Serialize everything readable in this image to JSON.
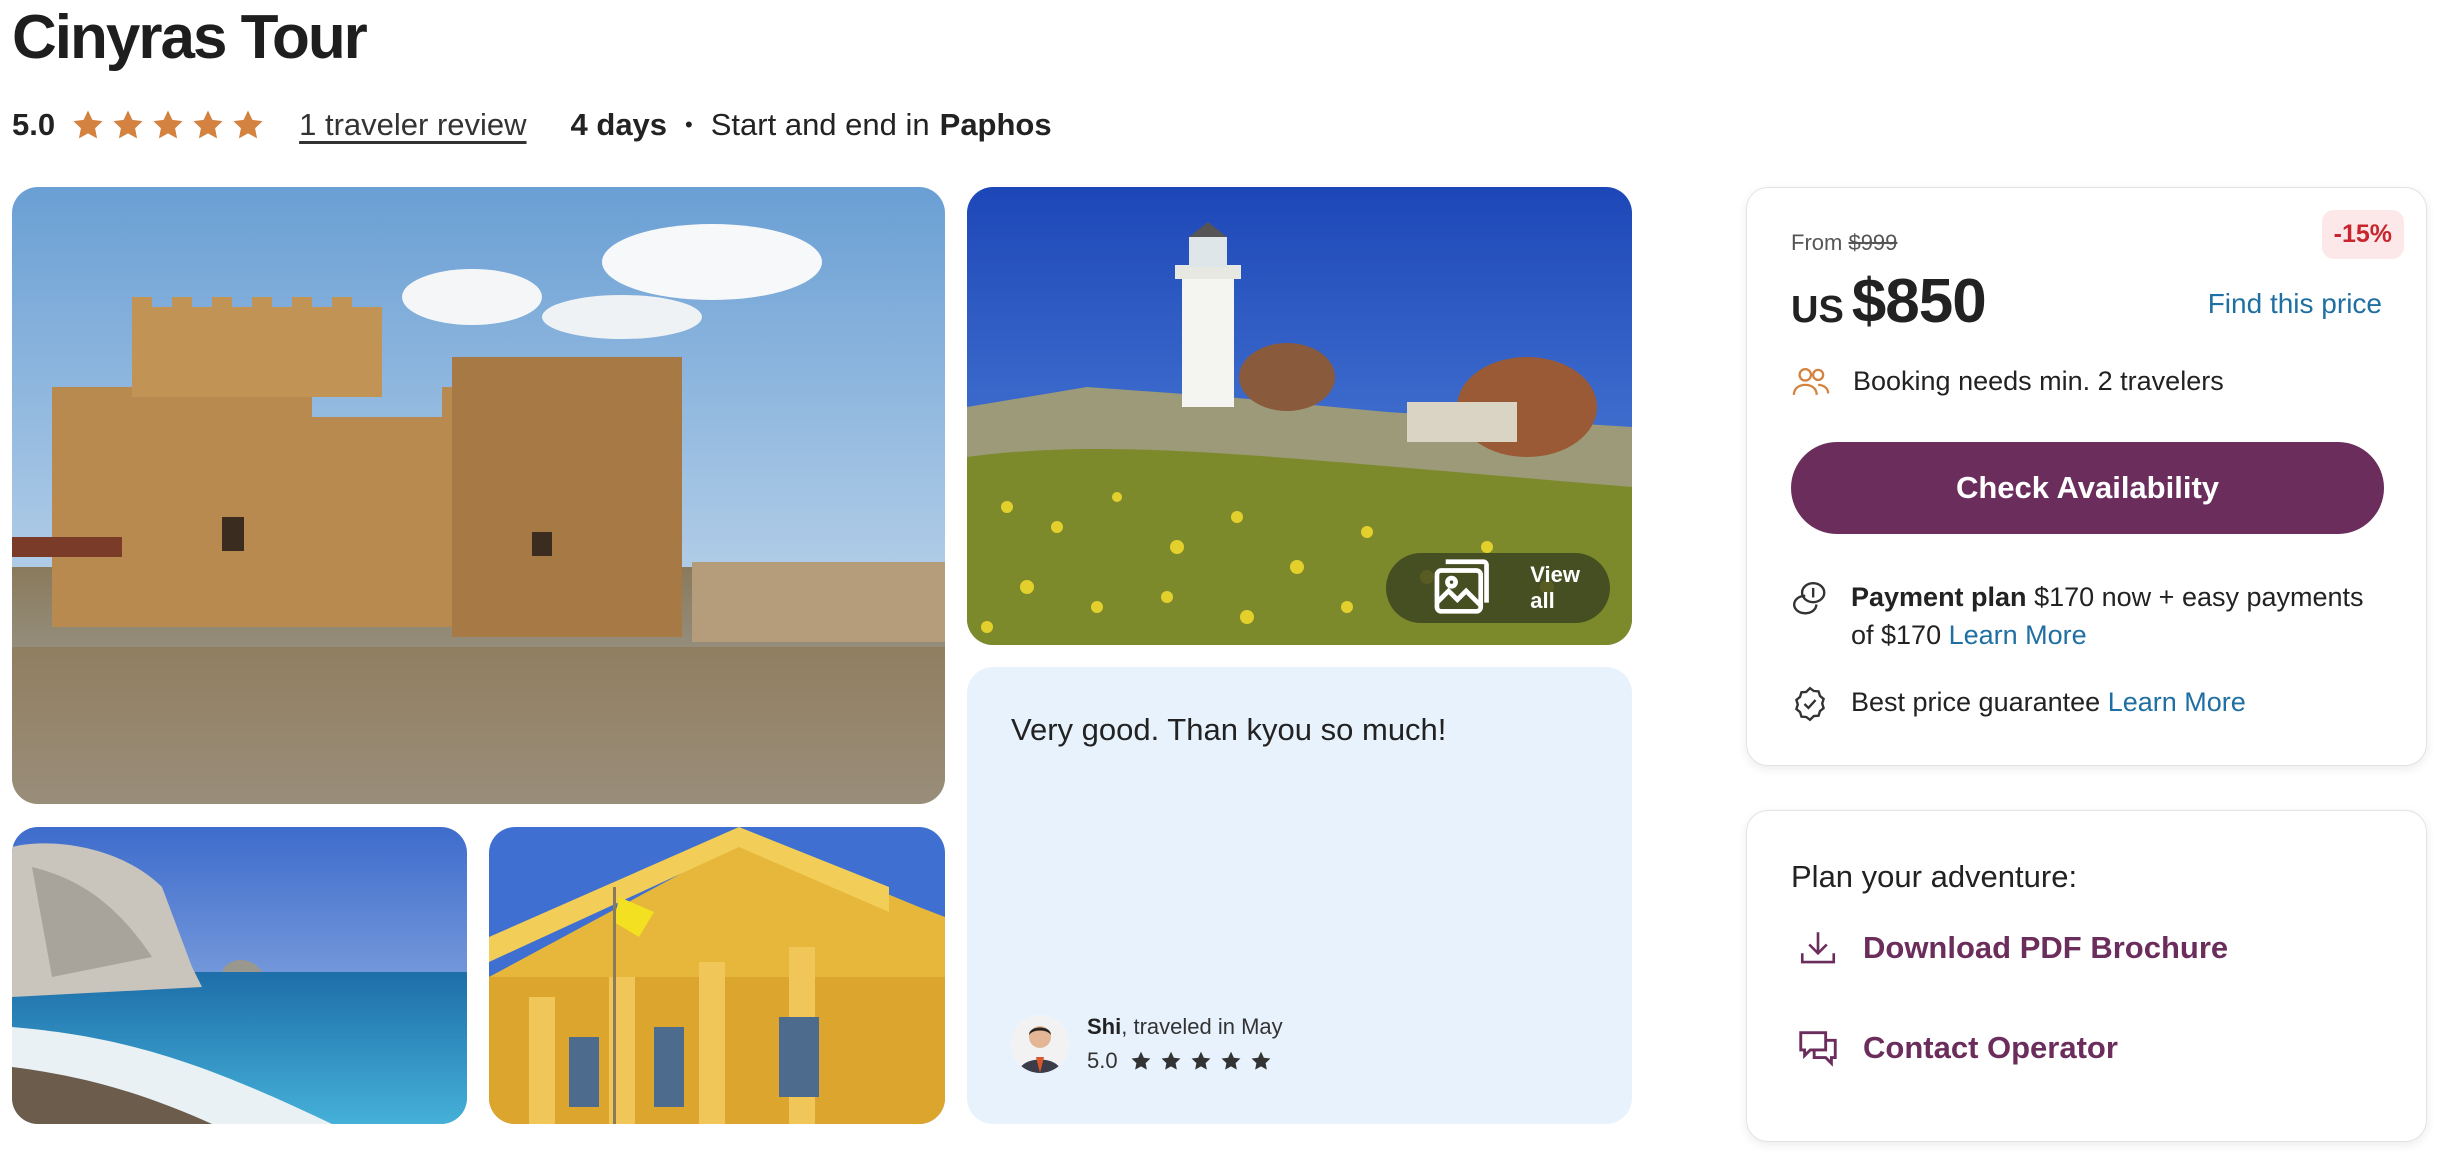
{
  "tour": {
    "title": "Cinyras Tour",
    "rating": "5.0",
    "stars": 5,
    "review_link": "1 traveler review",
    "duration": "4 days",
    "route_prefix": "Start and end in",
    "city": "Paphos"
  },
  "gallery": {
    "view_all_label": "View all",
    "images": [
      "castle-photo",
      "lighthouse-photo",
      "rock-beach-photo",
      "church-photo"
    ]
  },
  "review": {
    "text": "Very good. Than kyou so much!",
    "reviewer_name": "Shi",
    "reviewer_note": ", traveled in May",
    "rating": "5.0",
    "stars": 5
  },
  "pricing": {
    "from_label": "From",
    "original_price": "$999",
    "discount": "-15%",
    "currency": "US",
    "price": "$850",
    "find_price": "Find this price",
    "booking_note": "Booking needs min. 2 travelers",
    "check_button": "Check Availability",
    "payment_plan_label": "Payment plan",
    "payment_plan_text": "$170 now + easy payments of $170",
    "learn_more": "Learn More",
    "guarantee_label": "Best price guarantee"
  },
  "plan": {
    "title": "Plan your adventure:",
    "download": "Download PDF Brochure",
    "contact": "Contact Operator"
  },
  "colors": {
    "star": "#d4823f",
    "brand": "#6b2d5c",
    "link": "#1f6fa3",
    "discount": "#c8262f",
    "review_bg": "#e8f2fd"
  }
}
